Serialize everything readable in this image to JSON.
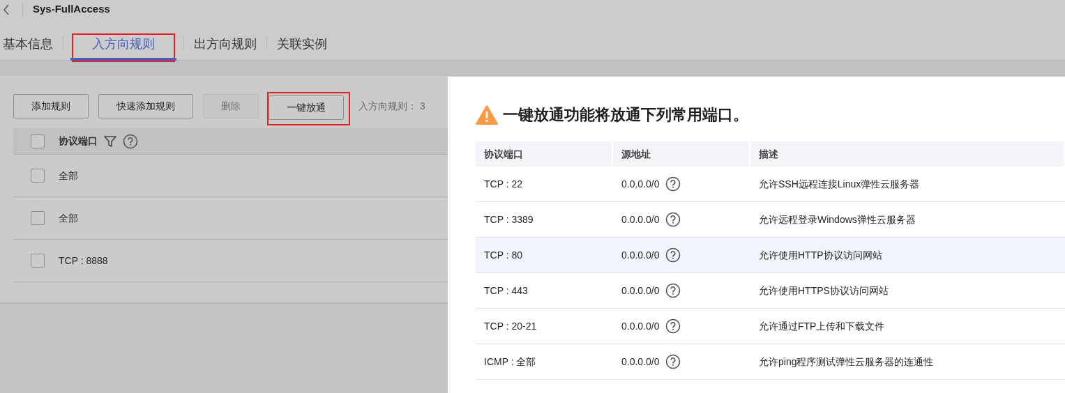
{
  "header": {
    "title": "Sys-FullAccess"
  },
  "tabs": [
    {
      "label": "基本信息",
      "selected": false,
      "outlined": false
    },
    {
      "label": "入方向规则",
      "selected": true,
      "outlined": true
    },
    {
      "label": "出方向规则",
      "selected": false,
      "outlined": false
    },
    {
      "label": "关联实例",
      "selected": false,
      "outlined": false
    }
  ],
  "toolbar": {
    "buttons": [
      {
        "label": "添加规则",
        "disabled": false,
        "outlined": false
      },
      {
        "label": "快速添加规则",
        "disabled": false,
        "outlined": false
      },
      {
        "label": "删除",
        "disabled": true,
        "outlined": false
      },
      {
        "label": "一键放通",
        "disabled": false,
        "outlined": true
      }
    ],
    "rule_count_label": "入方向规则：",
    "rule_count": "3"
  },
  "rules_table": {
    "header_checked": false,
    "columns": [
      "协议端口"
    ],
    "rows": [
      {
        "port": "全部",
        "checked": false
      },
      {
        "port": "全部",
        "checked": false
      },
      {
        "port": "TCP : 8888",
        "checked": false
      }
    ]
  },
  "drawer": {
    "title": "一键放通功能将放通下列常用端口。",
    "columns": [
      "协议端口",
      "源地址",
      "描述"
    ],
    "rows": [
      {
        "port": "TCP : 22",
        "source": "0.0.0.0/0",
        "description": "允许SSH远程连接Linux弹性云服务器",
        "hovered": false
      },
      {
        "port": "TCP : 3389",
        "source": "0.0.0.0/0",
        "description": "允许远程登录Windows弹性云服务器",
        "hovered": false
      },
      {
        "port": "TCP : 80",
        "source": "0.0.0.0/0",
        "description": "允许使用HTTP协议访问网站",
        "hovered": true
      },
      {
        "port": "TCP : 443",
        "source": "0.0.0.0/0",
        "description": "允许使用HTTPS协议访问网站",
        "hovered": false
      },
      {
        "port": "TCP : 20-21",
        "source": "0.0.0.0/0",
        "description": "允许通过FTP上传和下载文件",
        "hovered": false
      },
      {
        "port": "ICMP : 全部",
        "source": "0.0.0.0/0",
        "description": "允许ping程序测试弹性云服务器的连通性",
        "hovered": false
      }
    ]
  }
}
